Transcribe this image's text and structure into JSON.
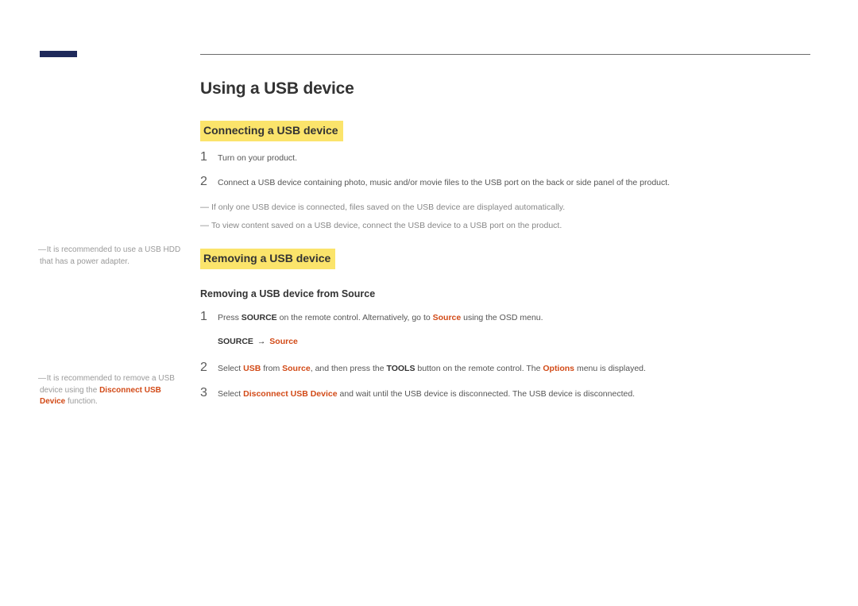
{
  "page": {
    "title": "Using a USB device"
  },
  "sidebar": {
    "note1": "It is recommended to use a USB HDD that has a power adapter.",
    "note2_pre": "It is recommended to remove a USB device using the ",
    "note2_hl": "Disconnect USB Device",
    "note2_post": " function."
  },
  "sections": {
    "connecting": {
      "heading": "Connecting a USB device",
      "steps": [
        {
          "n": "1",
          "text": "Turn on your product."
        },
        {
          "n": "2",
          "text": "Connect a USB device containing photo, music and/or movie files to the USB port on the back or side panel of the product."
        }
      ],
      "notes": [
        "If only one USB device is connected, files saved on the USB device are displayed automatically.",
        "To view content saved on a USB device, connect the USB device to a USB port on the product."
      ]
    },
    "removing": {
      "heading": "Removing a USB device",
      "subheading": "Removing a USB device from Source",
      "step1": {
        "n": "1",
        "pre": "Press ",
        "b1": "SOURCE",
        "mid": " on the remote control. Alternatively, go to ",
        "o1": "Source",
        "post": " using the OSD menu."
      },
      "path": {
        "a": "SOURCE",
        "arrow": "→",
        "b": "Source"
      },
      "step2": {
        "n": "2",
        "pre": "Select ",
        "o1": "USB",
        "m1": " from ",
        "o2": "Source",
        "m2": ", and then press the ",
        "b1": "TOOLS",
        "m3": " button on the remote control. The ",
        "o3": "Options",
        "post": " menu is displayed."
      },
      "step3": {
        "n": "3",
        "pre": "Select ",
        "o1": "Disconnect USB Device",
        "post": " and wait until the USB device is disconnected. The USB device is disconnected."
      }
    }
  }
}
